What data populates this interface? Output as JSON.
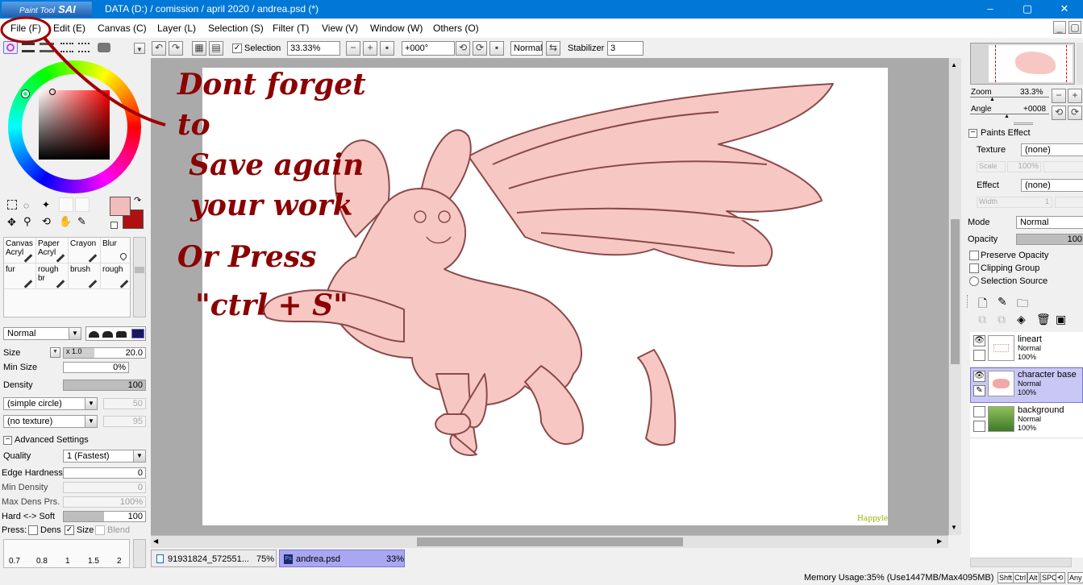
{
  "app": {
    "logo_small": "Paint Tool",
    "logo_big": "SAI",
    "title": "DATA (D:) / comission / april 2020 / andrea.psd (*)"
  },
  "window_controls": {
    "minimize": "–",
    "maximize": "▢",
    "close": "✕"
  },
  "menu": [
    "File (F)",
    "Edit (E)",
    "Canvas (C)",
    "Layer (L)",
    "Selection (S)",
    "Filter (T)",
    "View (V)",
    "Window (W)",
    "Others (O)"
  ],
  "toolbar": {
    "selection_label": "Selection",
    "zoom": "33.33%",
    "rotation": "+000°",
    "blend_mode": "Normal",
    "stabilizer_label": "Stabilizer",
    "stabilizer_value": "3"
  },
  "brush_tools": [
    {
      "name": "Canvas",
      "sub": "Acryl"
    },
    {
      "name": "Paper",
      "sub": "Acryl"
    },
    {
      "name": "Crayon",
      "sub": ""
    },
    {
      "name": "Blur",
      "sub": ""
    },
    {
      "name": "fur",
      "sub": ""
    },
    {
      "name": "rough br",
      "sub": ""
    },
    {
      "name": "brush",
      "sub": ""
    },
    {
      "name": "rough",
      "sub": ""
    }
  ],
  "brush_settings": {
    "mode": "Normal",
    "size_label": "Size",
    "size_multiplier": "x 1.0",
    "size_value": "20.0",
    "min_size_label": "Min Size",
    "min_size_value": "0%",
    "density_label": "Density",
    "density_value": "100",
    "shape": "(simple circle)",
    "shape_value": "50",
    "texture": "(no texture)",
    "texture_value": "95",
    "advanced_label": "Advanced Settings",
    "quality_label": "Quality",
    "quality_value": "1 (Fastest)",
    "edge_hardness_label": "Edge Hardness",
    "edge_hardness_value": "0",
    "min_density_label": "Min Density",
    "min_density_value": "0",
    "max_dens_label": "Max Dens Prs.",
    "max_dens_value": "100%",
    "hard_soft_label": "Hard <-> Soft",
    "hard_soft_value": "100",
    "press_label": "Press:",
    "press_dens": "Dens",
    "press_size": "Size",
    "press_blend": "Blend"
  },
  "brush_sizes": [
    "0.7",
    "0.8",
    "1",
    "1.5",
    "2"
  ],
  "annotation": {
    "line1": "Dont forget to",
    "line2": "Save again",
    "line3": "your work",
    "line4": "Or Press",
    "line5": "\"ctrl + S\""
  },
  "signature": "Happylemon",
  "doc_tabs": [
    {
      "name": "91931824_572551...",
      "zoom": "75%"
    },
    {
      "name": "andrea.psd",
      "zoom": "33%"
    }
  ],
  "navigator": {
    "zoom_label": "Zoom",
    "zoom_value": "33.3%",
    "angle_label": "Angle",
    "angle_value": "+0008"
  },
  "paints_effect": {
    "header": "Paints Effect",
    "texture_label": "Texture",
    "texture_value": "(none)",
    "scale_label": "Scale",
    "scale_value": "100%",
    "effect_label": "Effect",
    "effect_value": "(none)",
    "width_label": "Width",
    "width_value": "1"
  },
  "layer_props": {
    "mode_label": "Mode",
    "mode_value": "Normal",
    "opacity_label": "Opacity",
    "opacity_value": "100",
    "preserve_opacity": "Preserve Opacity",
    "clipping_group": "Clipping Group",
    "selection_source": "Selection Source"
  },
  "layers": [
    {
      "name": "lineart",
      "mode": "Normal",
      "opacity": "100%"
    },
    {
      "name": "character base",
      "mode": "Normal",
      "opacity": "100%"
    },
    {
      "name": "background",
      "mode": "Normal",
      "opacity": "100%"
    }
  ],
  "status": {
    "memory": "Memory Usage:35% (Use1447MB/Max4095MB)",
    "keys": [
      "Shft",
      "Ctrl",
      "Alt",
      "SPC",
      "⟲",
      "Any"
    ]
  },
  "colors": {
    "title_blue": "#0078d7",
    "annot_red": "#8b0000",
    "creature_fill": "#f7c8c3",
    "creature_line": "#8a4a4a",
    "selected_layer": "#c9c8f5",
    "active_tab": "#a9a6f2",
    "main_color": "#f2bcbc",
    "sub_color": "#b01010"
  }
}
